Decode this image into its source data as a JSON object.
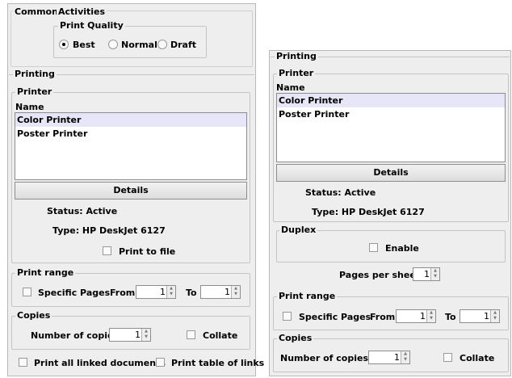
{
  "left": {
    "common": {
      "title": "Common",
      "activities_label": "Activities",
      "print_quality": {
        "title": "Print Quality",
        "options": [
          "Best",
          "Normal",
          "Draft"
        ],
        "selected": "Best"
      }
    },
    "printing": {
      "title": "Printing",
      "printer_title": "Printer",
      "name_label": "Name",
      "printers": [
        "Color Printer",
        "Poster Printer"
      ],
      "selected_printer": "Color Printer",
      "details_button": "Details",
      "status": "Status: Active",
      "type": "Type: HP DeskJet 6127",
      "print_to_file": "Print to file"
    },
    "print_range": {
      "title": "Print range",
      "specific_pages": "Specific Pages",
      "from_label": "From",
      "from_value": "1",
      "to_label": "To",
      "to_value": "1"
    },
    "copies": {
      "title": "Copies",
      "number_label": "Number of copies",
      "number_value": "1",
      "collate": "Collate"
    },
    "footer": {
      "linked_docs": "Print all linked documents",
      "table_links": "Print table of links"
    }
  },
  "right": {
    "printing": {
      "title": "Printing",
      "printer_title": "Printer",
      "name_label": "Name",
      "printers": [
        "Color Printer",
        "Poster Printer"
      ],
      "selected_printer": "Color Printer",
      "details_button": "Details",
      "status": "Status: Active",
      "type": "Type: HP DeskJet 6127"
    },
    "duplex": {
      "title": "Duplex",
      "enable": "Enable"
    },
    "pages_per_sheet": {
      "label": "Pages per sheet",
      "value": "1"
    },
    "print_range": {
      "title": "Print range",
      "specific_pages": "Specific Pages",
      "from_label": "From",
      "from_value": "1",
      "to_label": "To",
      "to_value": "1"
    },
    "copies": {
      "title": "Copies",
      "number_label": "Number of copies",
      "number_value": "1",
      "collate": "Collate"
    }
  }
}
